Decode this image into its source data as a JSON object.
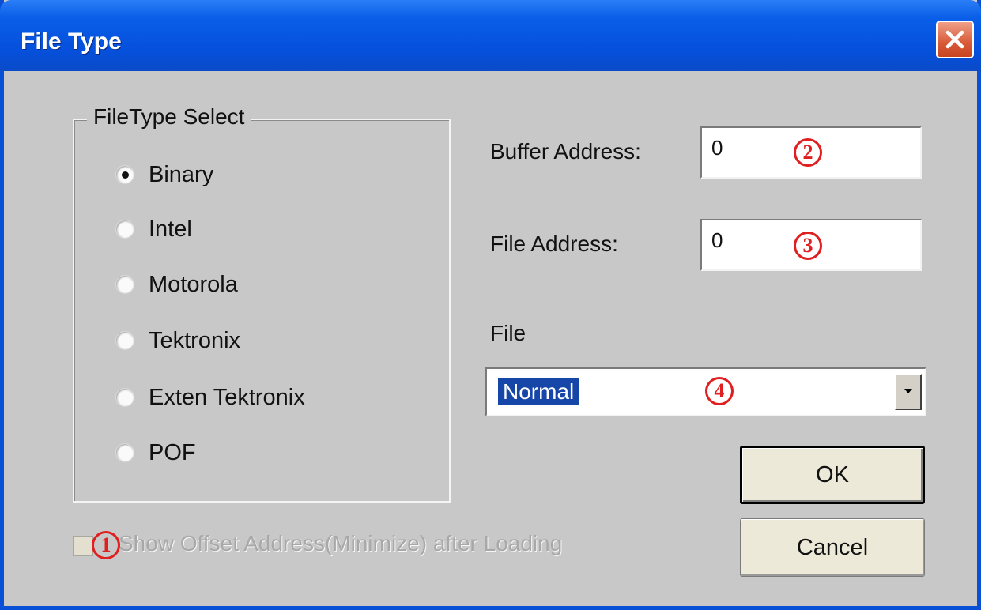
{
  "window": {
    "title": "File Type"
  },
  "filetype_group": {
    "legend": "FileType Select",
    "options": [
      {
        "label": "Binary",
        "selected": true
      },
      {
        "label": "Intel",
        "selected": false
      },
      {
        "label": "Motorola",
        "selected": false
      },
      {
        "label": "Tektronix",
        "selected": false
      },
      {
        "label": "Exten Tektronix",
        "selected": false
      },
      {
        "label": "POF",
        "selected": false
      }
    ]
  },
  "buffer_address": {
    "label": "Buffer Address:",
    "value": "0"
  },
  "file_address": {
    "label": "File Address:",
    "value": "0"
  },
  "file_mode": {
    "label": "File",
    "selected": "Normal"
  },
  "buttons": {
    "ok": "OK",
    "cancel": "Cancel"
  },
  "show_offset": {
    "label": "Show Offset Address(Minimize) after Loading",
    "checked": false,
    "enabled": false
  },
  "annotations": [
    "1",
    "2",
    "3",
    "4"
  ],
  "colors": {
    "title_bar": "#0550dc",
    "selection": "#1646a8",
    "annotation": "#e02020"
  }
}
